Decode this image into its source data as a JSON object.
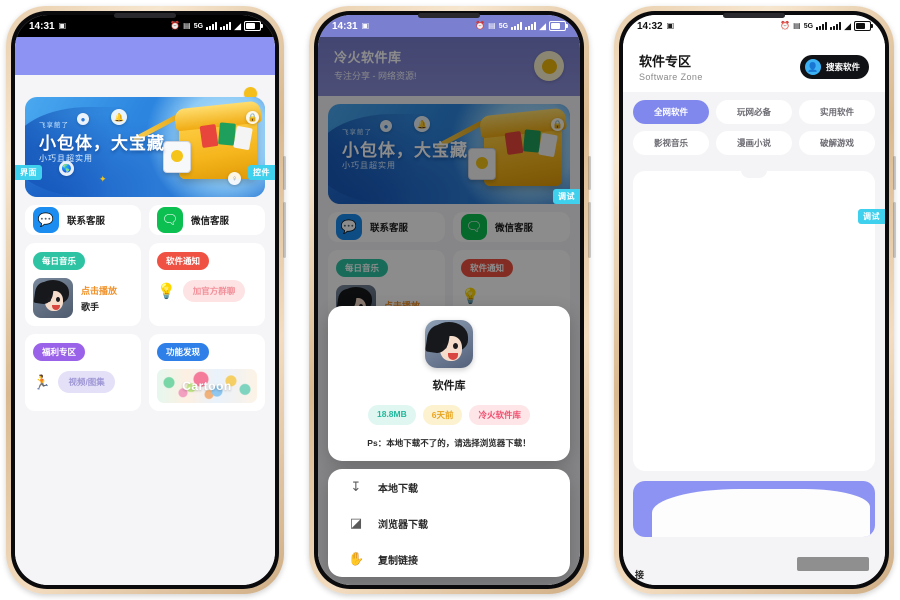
{
  "screens": [
    {
      "id": "home",
      "status": {
        "time": "14:31",
        "alarm_icon": "alarm-icon",
        "dnd_icon": "dnd-icon",
        "net_label": "5G",
        "wifi_icon": "wifi-icon",
        "battery_icon": "battery-icon"
      },
      "edge_tags": {
        "left": "界面",
        "right": "控件"
      },
      "hero": {
        "kicker": "飞享館了",
        "title": "小包体，大宝藏",
        "subtitle": "小巧且超实用"
      },
      "services": [
        {
          "label": "联系客服",
          "icon": "qq-icon"
        },
        {
          "label": "微信客服",
          "icon": "wechat-icon"
        }
      ],
      "cards": {
        "music": {
          "badge": "每日音乐",
          "play": "点击播放",
          "artist": "歌手"
        },
        "notify": {
          "badge": "软件通知",
          "icon": "lightbulb-icon",
          "action": "加官方群聊"
        },
        "welfare": {
          "badge": "福利专区",
          "icon": "rocket-icon",
          "action": "视频/图集"
        },
        "discover": {
          "badge": "功能发现",
          "banner_text": "Cartoon"
        }
      }
    },
    {
      "id": "download-modal",
      "status": {
        "time": "14:31",
        "alarm_icon": "alarm-icon",
        "dnd_icon": "dnd-icon",
        "net_label": "5G",
        "wifi_icon": "wifi-icon",
        "battery_icon": "battery-icon"
      },
      "header": {
        "title": "冷火软件库",
        "subtitle": "专注分享 - 网络资源!",
        "badge_icon": "sun-icon"
      },
      "edge_tag": "调试",
      "modal": {
        "app_name": "软件库",
        "app_icon": "app-avatar-icon",
        "tags": [
          "18.8MB",
          "6天前",
          "冷火软件库"
        ],
        "note": "Ps：本地下载不了的，请选择浏览器下载！"
      },
      "actions": [
        {
          "label": "本地下载",
          "icon": "download-icon"
        },
        {
          "label": "浏览器下载",
          "icon": "browser-icon"
        },
        {
          "label": "复制链接",
          "icon": "hand-icon"
        }
      ]
    },
    {
      "id": "software-zone",
      "status": {
        "time": "14:32",
        "alarm_icon": "alarm-icon",
        "dnd_icon": "dnd-icon",
        "net_label": "5G",
        "wifi_icon": "wifi-icon",
        "battery_icon": "battery-icon"
      },
      "header": {
        "title": "软件专区",
        "subtitle": "Software Zone",
        "search_label": "搜索软件",
        "search_icon": "person-icon"
      },
      "edge_tag": "调试",
      "chips": [
        "全网软件",
        "玩网必备",
        "实用软件",
        "影视音乐",
        "漫画小说",
        "破解游戏"
      ],
      "active_chip": "全网软件",
      "bottom_text": "接"
    }
  ],
  "colors": {
    "accent_purple": "#8d93f2",
    "debug_cyan": "#3fd0ee",
    "qq_blue": "#1b8df0",
    "wechat_green": "#0bbf50",
    "teal": "#2ec4a3",
    "red": "#ef5142",
    "purple": "#9a62e8",
    "blue": "#2e7fe8",
    "orange": "#f0922b"
  }
}
